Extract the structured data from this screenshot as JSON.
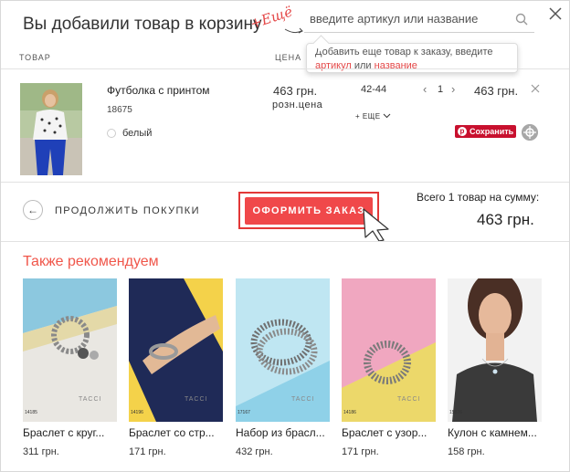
{
  "header": {
    "title": "Вы добавили товар в корзину",
    "add_more_label": "+Ещё",
    "search_placeholder": "введите артикул или название"
  },
  "hint": {
    "text_before": "Добавить еще товар к заказу, введите",
    "link_sku": "артикул",
    "or": "или",
    "link_name": "название"
  },
  "table_headers": {
    "product": "ТОВАР",
    "price": "ЦЕНА"
  },
  "cart_item": {
    "name": "Футболка с принтом",
    "code": "18675",
    "color": "белый",
    "price": "463 грн.",
    "price_type": "розн.цена",
    "size": "42-44",
    "more_label": "+ ЕЩЕ",
    "qty": "1",
    "total": "463 грн.",
    "save_label": "Сохранить"
  },
  "footer": {
    "continue_label": "ПРОДОЛЖИТЬ ПОКУПКИ",
    "checkout_label": "ОФОРМИТЬ ЗАКАЗ",
    "sum_label": "Всего 1 товар на сумму:",
    "sum_value": "463 грн."
  },
  "recommendations": {
    "title": "Также рекомендуем",
    "items": [
      {
        "code": "14185",
        "brand": "TACCI",
        "name": "Браслет с круг...",
        "price": "311 грн."
      },
      {
        "code": "14196",
        "brand": "TACCI",
        "name": "Браслет со стр...",
        "price": "171 грн."
      },
      {
        "code": "17167",
        "brand": "TACCI",
        "name": "Набор из брасл...",
        "price": "432 грн."
      },
      {
        "code": "14186",
        "brand": "TACCI",
        "name": "Браслет с узор...",
        "price": "171 грн."
      },
      {
        "code": "15826",
        "brand": "",
        "name": "Кулон с камнем...",
        "price": "158 грн."
      }
    ]
  },
  "colors": {
    "accent": "#f0484a",
    "save": "#c8102e",
    "link": "#e44848"
  }
}
